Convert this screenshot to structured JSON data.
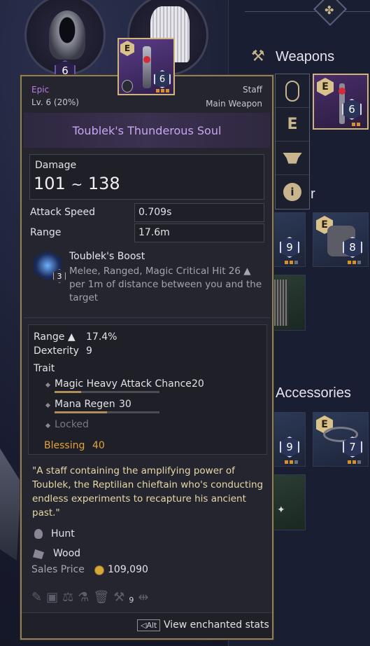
{
  "equipment_top": {
    "helmet_level": "6"
  },
  "sections": {
    "weapons": "Weapons",
    "armor_partial": "r",
    "accessories": "Accessories"
  },
  "weapon_tile": {
    "badge": "E",
    "level": "6"
  },
  "armor_tiles": [
    {
      "level": "9"
    },
    {
      "badge": "E",
      "level": "8"
    }
  ],
  "accessory_tiles": [
    {
      "level": "9"
    },
    {
      "badge": "E",
      "level": "7"
    }
  ],
  "side_menu": [
    "mouse-icon",
    "enchant-e-icon",
    "anvil-icon",
    "info-icon"
  ],
  "hover_item": {
    "badge": "E",
    "level": "6"
  },
  "tooltip": {
    "rarity": "Epic",
    "level": "Lv. 6 (20%)",
    "type": "Staff",
    "slot": "Main Weapon",
    "name": "Toublek's Thunderous Soul",
    "damage_label": "Damage",
    "damage_min": "101",
    "damage_sep": "~",
    "damage_max": "138",
    "attack_speed_label": "Attack Speed",
    "attack_speed_value": "0.709s",
    "range_label": "Range",
    "range_value": "17.6m",
    "boost": {
      "level": "3",
      "title": "Toublek's Boost",
      "description": "Melee, Ranged, Magic Critical Hit 26 ▲ per 1m of distance between you and the target"
    },
    "extra_stats": [
      {
        "label": "Range ▲",
        "value": "17.4%"
      },
      {
        "label": "Dexterity",
        "value": "9"
      }
    ],
    "trait_label": "Trait",
    "traits": [
      {
        "name": "Magic Heavy Attack Chance",
        "value": "20",
        "fill": 0.25
      },
      {
        "name": "Mana Regen",
        "value": "30",
        "fill": 0.5
      },
      {
        "name": "Locked",
        "value": "",
        "fill": 0
      }
    ],
    "blessing_label": "Blessing",
    "blessing_value": "40",
    "quote": "\"A staff containing the amplifying power of Toublek, the Reptilian chieftain who's conducting endless experiments to recapture his ancient past.\"",
    "acquisition": "Hunt",
    "material": "Wood",
    "sales_price_label": "Sales Price",
    "sales_price_value": "109,090",
    "action_count": "9",
    "alt_key": "Alt",
    "alt_text": "View enchanted stats"
  }
}
